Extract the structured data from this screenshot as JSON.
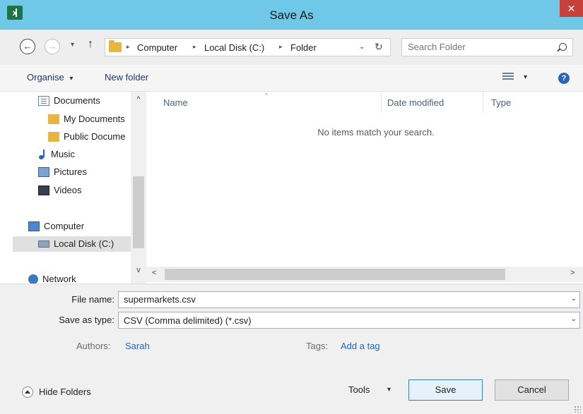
{
  "window": {
    "title": "Save As",
    "close_symbol": "✕",
    "app_icon_text": "x"
  },
  "address_bar": {
    "back_symbol": "←",
    "forward_symbol": "→",
    "recent_symbol": "▾",
    "up_symbol": "↑",
    "breadcrumb": [
      "Computer",
      "Local Disk (C:)",
      "Folder"
    ],
    "separator_symbol": "▸",
    "dropdown_symbol": "⌄",
    "refresh_symbol": "↻"
  },
  "search": {
    "placeholder": "Search Folder"
  },
  "toolbar": {
    "organise_label": "Organise",
    "organise_arrow": "▾",
    "new_folder_label": "New folder",
    "view_arrow": "▾",
    "help_symbol": "?"
  },
  "navigation": {
    "items": [
      {
        "label": "Documents",
        "icon": "documents-icon"
      },
      {
        "label": "My Documents",
        "icon": "folder-icon"
      },
      {
        "label": "Public Docume",
        "icon": "folder-icon"
      },
      {
        "label": "Music",
        "icon": "music-icon"
      },
      {
        "label": "Pictures",
        "icon": "pictures-icon"
      },
      {
        "label": "Videos",
        "icon": "videos-icon"
      },
      {
        "label": "Computer",
        "icon": "computer-icon"
      },
      {
        "label": "Local Disk (C:)",
        "icon": "disk-icon",
        "selected": true
      },
      {
        "label": "Network",
        "icon": "network-icon"
      }
    ],
    "scroll_up_symbol": "^",
    "scroll_down_symbol": "v"
  },
  "file_list": {
    "columns": [
      "Name",
      "Date modified",
      "Type"
    ],
    "sort_symbol": "^",
    "empty_message": "No items match your search.",
    "scroll_left_symbol": "<",
    "scroll_right_symbol": ">"
  },
  "form": {
    "file_name_label": "File name:",
    "file_name_value": "supermarkets.csv",
    "save_type_label": "Save as type:",
    "save_type_value": "CSV (Comma delimited) (*.csv)",
    "dropdown_symbol": "⌄",
    "authors_label": "Authors:",
    "authors_value": "Sarah",
    "tags_label": "Tags:",
    "tags_value": "Add a tag"
  },
  "footer": {
    "hide_folders_label": "Hide Folders",
    "tools_label": "Tools",
    "tools_arrow": "▾",
    "save_label": "Save",
    "cancel_label": "Cancel"
  },
  "colors": {
    "title_bar": "#6fc8e8",
    "close_button": "#c7413a",
    "link": "#2a64b8",
    "form_background": "#f0f0f0"
  }
}
